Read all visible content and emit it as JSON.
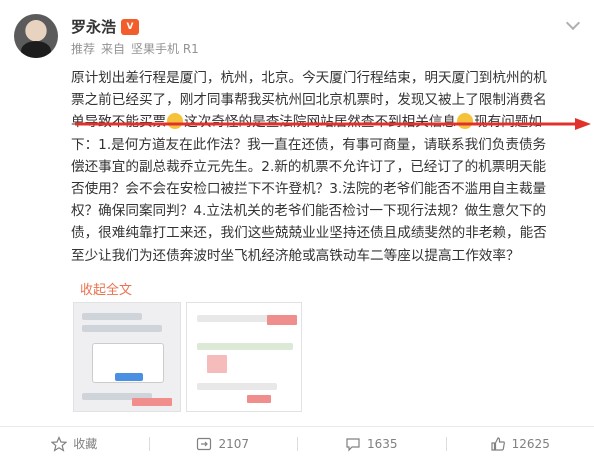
{
  "author": {
    "name": "罗永浩",
    "badge": "V"
  },
  "meta": {
    "label": "推荐",
    "from": "来自",
    "device": "坚果手机 R1"
  },
  "post": {
    "line1": "原计划出差行程是厦门，杭州，北京。今天厦门行程结束，明天厦门到杭州的机",
    "line2": "票之前已经买了，刚才同事帮我买杭州回北京机票时，发现又被上了限制消费名",
    "line3_a": "单导致不能买票",
    "line3_b": "这次奇怪的是查法院网站居然查不到相关信息",
    "line3_c": "现有问题如",
    "line4": "下：1.是何方道友在此作法？我一直在还债，有事可商量，请联系我们负责债务",
    "line5": "偿还事宜的副总裁乔立元先生。2.新的机票不允许订了，已经订了的机票明天能",
    "line6": "否使用？会不会在安检口被拦下不许登机？3.法院的老爷们能否不滥用自主裁量",
    "line7": "权？确保同案同判？4.立法机关的老爷们能否检讨一下现行法规？做生意欠下的",
    "line8": "债，很难纯靠打工来还，我们这些兢兢业业坚持还债且成绩斐然的非老赖，能否",
    "line9": "至少让我们为还债奔波时坐飞机经济舱或高铁动车二等座以提高工作效率？"
  },
  "collapse_label": "收起全文",
  "images": [
    {
      "icon": "screenshot-image"
    },
    {
      "icon": "screenshot-image"
    }
  ],
  "footer": {
    "favorite": "收藏",
    "repost": "2107",
    "comment": "1635",
    "like": "12625"
  },
  "colors": {
    "accent": "#eb7350",
    "arrow": "#e0322b",
    "text": "#333333",
    "meta": "#939393"
  }
}
